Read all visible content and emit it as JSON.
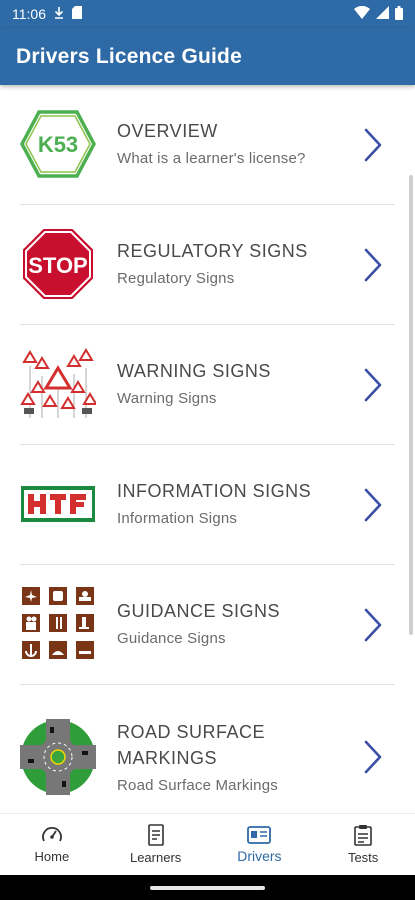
{
  "status_bar": {
    "time": "11:06",
    "icons": [
      "download-icon",
      "sd-card-icon",
      "wifi-icon",
      "signal-icon",
      "battery-icon"
    ]
  },
  "app_bar": {
    "title": "Drivers Licence Guide",
    "color": "#2e6aa5"
  },
  "list": {
    "items": [
      {
        "title": "OVERVIEW",
        "subtitle": "What is a learner's license?",
        "icon": "k53-hexagon-icon"
      },
      {
        "title": "REGULATORY SIGNS",
        "subtitle": "Regulatory Signs",
        "icon": "stop-sign-icon",
        "icon_text": "STOP"
      },
      {
        "title": "WARNING SIGNS",
        "subtitle": "Warning Signs",
        "icon": "warning-signs-icon"
      },
      {
        "title": "INFORMATION SIGNS",
        "subtitle": "Information Signs",
        "icon": "information-signs-icon"
      },
      {
        "title": "GUIDANCE SIGNS",
        "subtitle": "Guidance Signs",
        "icon": "guidance-signs-icon"
      },
      {
        "title": "ROAD SURFACE MARKINGS",
        "subtitle": "Road Surface Markings",
        "icon": "roundabout-icon"
      }
    ],
    "k53_text": "K53",
    "chevron_color": "#3a4fa5"
  },
  "bottom_nav": {
    "tabs": [
      {
        "label": "Home",
        "icon": "speedometer-icon"
      },
      {
        "label": "Learners",
        "icon": "document-icon"
      },
      {
        "label": "Drivers",
        "icon": "id-card-icon",
        "active": true
      },
      {
        "label": "Tests",
        "icon": "clipboard-icon"
      }
    ],
    "active_color": "#2e6aa5"
  }
}
